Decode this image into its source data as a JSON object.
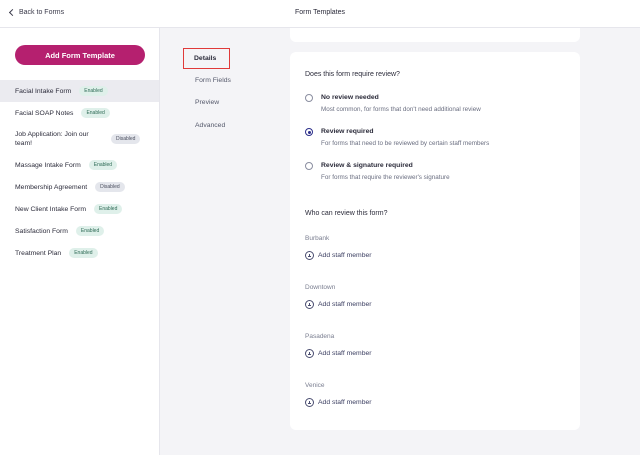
{
  "header": {
    "back_label": "Back to Forms",
    "title": "Form Templates"
  },
  "sidebar": {
    "add_button_label": "Add Form Template",
    "templates": [
      {
        "name": "Facial Intake Form",
        "status": "Enabled",
        "active": true
      },
      {
        "name": "Facial SOAP Notes",
        "status": "Enabled"
      },
      {
        "name": "Job Application: Join our team!",
        "status": "Disabled"
      },
      {
        "name": "Massage Intake Form",
        "status": "Enabled"
      },
      {
        "name": "Membership Agreement",
        "status": "Disabled"
      },
      {
        "name": "New Client Intake Form",
        "status": "Enabled"
      },
      {
        "name": "Satisfaction Form",
        "status": "Enabled"
      },
      {
        "name": "Treatment Plan",
        "status": "Enabled"
      }
    ]
  },
  "subnav": {
    "items": [
      "Details",
      "Form Fields",
      "Preview",
      "Advanced"
    ],
    "selected": "Details"
  },
  "review": {
    "question": "Does this form require review?",
    "options": [
      {
        "label": "No review needed",
        "description": "Most common, for forms that don't need additional review",
        "checked": false
      },
      {
        "label": "Review required",
        "description": "For forms that need to be reviewed by certain staff members",
        "checked": true
      },
      {
        "label": "Review & signature required",
        "description": "For forms that require the reviewer's signature",
        "checked": false
      }
    ]
  },
  "reviewers": {
    "question": "Who can review this form?",
    "add_label": "Add staff member",
    "locations": [
      "Burbank",
      "Downtown",
      "Pasadena",
      "Venice"
    ]
  },
  "colors": {
    "accent": "#b5206f",
    "radio_selected": "#2c2f8a",
    "highlight_box": "#e03a3a"
  }
}
